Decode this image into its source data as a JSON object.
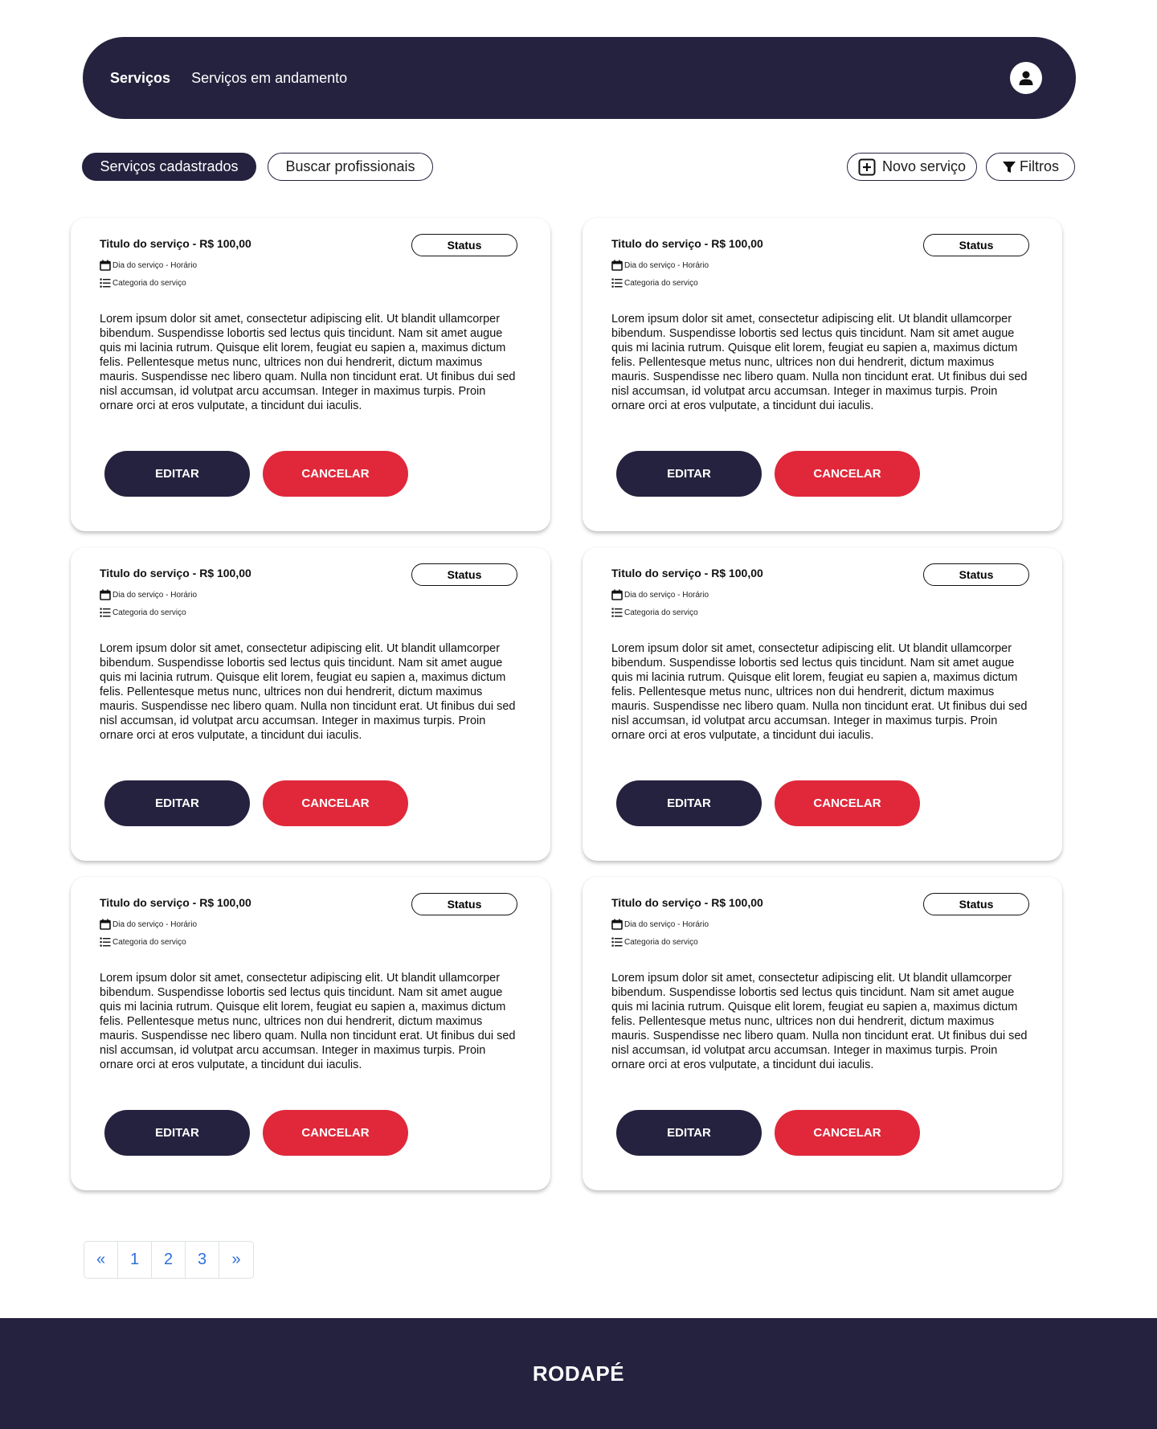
{
  "nav": {
    "links": [
      "Serviços",
      "Serviços em andamento"
    ],
    "avatar_icon": "user-avatar-icon"
  },
  "toolbar": {
    "registered_services": "Serviços cadastrados",
    "find_professionals": "Buscar profissionais",
    "new_service": "Novo serviço",
    "filters": "Filtros"
  },
  "cards": [
    {
      "title": "Titulo do serviço - R$ 100,00",
      "status": "Status",
      "date": "Dia do serviço - Horário",
      "category": "Categoria do serviço",
      "description": "Lorem ipsum dolor sit amet, consectetur adipiscing elit. Ut blandit ullamcorper bibendum. Suspendisse lobortis sed lectus quis tincidunt. Nam sit amet augue quis mi lacinia rutrum. Quisque elit lorem, feugiat eu sapien a, maximus dictum felis. Pellentesque metus nunc, ultrices non dui hendrerit, dictum maximus mauris. Suspendisse nec libero quam. Nulla non tincidunt erat. Ut finibus dui sed nisl accumsan, id volutpat arcu accumsan. Integer in maximus turpis. Proin ornare orci at eros vulputate, a tincidunt dui iaculis.",
      "edit_label": "EDITAR",
      "cancel_label": "CANCELAR"
    },
    {
      "title": "Titulo do serviço - R$ 100,00",
      "status": "Status",
      "date": "Dia do serviço - Horário",
      "category": "Categoria do serviço",
      "description": "Lorem ipsum dolor sit amet, consectetur adipiscing elit. Ut blandit ullamcorper bibendum. Suspendisse lobortis sed lectus quis tincidunt. Nam sit amet augue quis mi lacinia rutrum. Quisque elit lorem, feugiat eu sapien a, maximus dictum felis. Pellentesque metus nunc, ultrices non dui hendrerit, dictum maximus mauris. Suspendisse nec libero quam. Nulla non tincidunt erat. Ut finibus dui sed nisl accumsan, id volutpat arcu accumsan. Integer in maximus turpis. Proin ornare orci at eros vulputate, a tincidunt dui iaculis.",
      "edit_label": "EDITAR",
      "cancel_label": "CANCELAR"
    },
    {
      "title": "Titulo do serviço - R$ 100,00",
      "status": "Status",
      "date": "Dia do serviço - Horário",
      "category": "Categoria do serviço",
      "description": "Lorem ipsum dolor sit amet, consectetur adipiscing elit. Ut blandit ullamcorper bibendum. Suspendisse lobortis sed lectus quis tincidunt. Nam sit amet augue quis mi lacinia rutrum. Quisque elit lorem, feugiat eu sapien a, maximus dictum felis. Pellentesque metus nunc, ultrices non dui hendrerit, dictum maximus mauris. Suspendisse nec libero quam. Nulla non tincidunt erat. Ut finibus dui sed nisl accumsan, id volutpat arcu accumsan. Integer in maximus turpis. Proin ornare orci at eros vulputate, a tincidunt dui iaculis.",
      "edit_label": "EDITAR",
      "cancel_label": "CANCELAR"
    },
    {
      "title": "Titulo do serviço - R$ 100,00",
      "status": "Status",
      "date": "Dia do serviço - Horário",
      "category": "Categoria do serviço",
      "description": "Lorem ipsum dolor sit amet, consectetur adipiscing elit. Ut blandit ullamcorper bibendum. Suspendisse lobortis sed lectus quis tincidunt. Nam sit amet augue quis mi lacinia rutrum. Quisque elit lorem, feugiat eu sapien a, maximus dictum felis. Pellentesque metus nunc, ultrices non dui hendrerit, dictum maximus mauris. Suspendisse nec libero quam. Nulla non tincidunt erat. Ut finibus dui sed nisl accumsan, id volutpat arcu accumsan. Integer in maximus turpis. Proin ornare orci at eros vulputate, a tincidunt dui iaculis.",
      "edit_label": "EDITAR",
      "cancel_label": "CANCELAR"
    },
    {
      "title": "Titulo do serviço - R$ 100,00",
      "status": "Status",
      "date": "Dia do serviço - Horário",
      "category": "Categoria do serviço",
      "description": "Lorem ipsum dolor sit amet, consectetur adipiscing elit. Ut blandit ullamcorper bibendum. Suspendisse lobortis sed lectus quis tincidunt. Nam sit amet augue quis mi lacinia rutrum. Quisque elit lorem, feugiat eu sapien a, maximus dictum felis. Pellentesque metus nunc, ultrices non dui hendrerit, dictum maximus mauris. Suspendisse nec libero quam. Nulla non tincidunt erat. Ut finibus dui sed nisl accumsan, id volutpat arcu accumsan. Integer in maximus turpis. Proin ornare orci at eros vulputate, a tincidunt dui iaculis.",
      "edit_label": "EDITAR",
      "cancel_label": "CANCELAR"
    },
    {
      "title": "Titulo do serviço - R$ 100,00",
      "status": "Status",
      "date": "Dia do serviço - Horário",
      "category": "Categoria do serviço",
      "description": "Lorem ipsum dolor sit amet, consectetur adipiscing elit. Ut blandit ullamcorper bibendum. Suspendisse lobortis sed lectus quis tincidunt. Nam sit amet augue quis mi lacinia rutrum. Quisque elit lorem, feugiat eu sapien a, maximus dictum felis. Pellentesque metus nunc, ultrices non dui hendrerit, dictum maximus mauris. Suspendisse nec libero quam. Nulla non tincidunt erat. Ut finibus dui sed nisl accumsan, id volutpat arcu accumsan. Integer in maximus turpis. Proin ornare orci at eros vulputate, a tincidunt dui iaculis.",
      "edit_label": "EDITAR",
      "cancel_label": "CANCELAR"
    }
  ],
  "pagination": {
    "prev": "«",
    "pages": [
      "1",
      "2",
      "3"
    ],
    "next": "»"
  },
  "footer": {
    "text": "RODAPÉ"
  },
  "colors": {
    "primary": "#25223f",
    "danger": "#e0283a",
    "link": "#2f6fdc"
  }
}
